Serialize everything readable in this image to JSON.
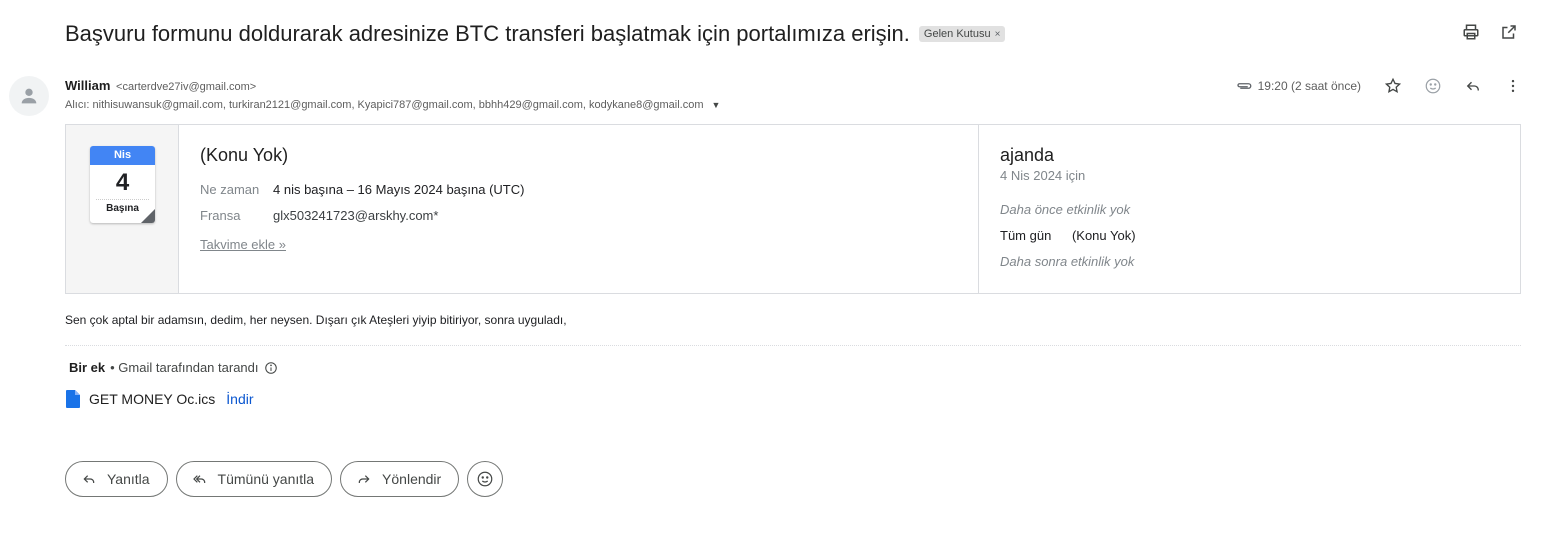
{
  "subject": {
    "text": "Başvuru formunu doldurarak adresinize BTC transferi başlatmak için portalımıza erişin.",
    "label": "Gelen Kutusu",
    "label_remove": "×",
    "print_icon": "print-icon",
    "newwindow_icon": "open-in-new-window-icon"
  },
  "sender": {
    "name": "William",
    "email": "<carterdve27iv@gmail.com>",
    "recipients": "Alıcı: nithisuwansuk@gmail.com, turkiran2121@gmail.com, Kyapici787@gmail.com, bbhh429@gmail.com, kodykane8@gmail.com"
  },
  "meta": {
    "time": "19:20 (2 saat önce)",
    "icons": [
      "attachment-icon",
      "star-icon",
      "emoji-icon",
      "reply-icon",
      "more-vert-icon"
    ]
  },
  "calendar": {
    "month": "Nis",
    "day": "4",
    "sub": "Başına",
    "event_title": "(Konu Yok)",
    "when_label": "Ne zaman",
    "when_value": "4 nis başına – 16 Mayıs 2024 başına (UTC)",
    "where_label": "Fransa",
    "where_value": "glx503241723@arskhy.com*",
    "add_link": "Takvime ekle »",
    "agenda_title": "ajanda",
    "agenda_date": "4 Nis 2024 için",
    "agenda_before": "Daha önce etkinlik yok",
    "agenda_allday": "Tüm gün",
    "agenda_event": "(Konu Yok)",
    "agenda_after": "Daha sonra etkinlik yok"
  },
  "body": {
    "text": "Sen çok aptal bir adamsın, dedim, her neysen. Dışarı çık Ateşleri yiyip bitiriyor, sonra uyguladı,"
  },
  "attachments": {
    "count_label": "Bir ek",
    "scanned": "• Gmail tarafından tarandı",
    "file_name": "GET MONEY Oc.ics",
    "download": "İndir"
  },
  "reply_bar": {
    "reply": "Yanıtla",
    "reply_all": "Tümünü yanıtla",
    "forward": "Yönlendir"
  },
  "colors": {
    "accent_blue": "#0b57d0",
    "calendar_blue": "#4285f4"
  }
}
